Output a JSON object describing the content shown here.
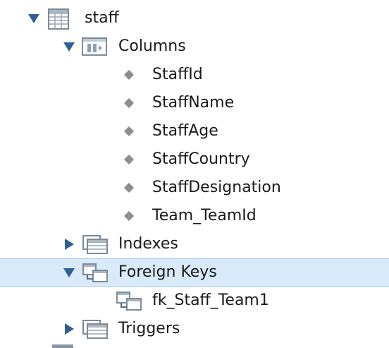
{
  "tree": {
    "table": {
      "label": "staff",
      "icon": "table-icon",
      "expanded": true
    },
    "columns": {
      "label": "Columns",
      "icon": "columns-folder-icon",
      "expanded": true,
      "items": [
        {
          "label": "StaffId"
        },
        {
          "label": "StaffName"
        },
        {
          "label": "StaffAge"
        },
        {
          "label": "StaffCountry"
        },
        {
          "label": "StaffDesignation"
        },
        {
          "label": "Team_TeamId"
        }
      ]
    },
    "indexes": {
      "label": "Indexes",
      "icon": "indexes-folder-icon",
      "expanded": false
    },
    "foreign_keys": {
      "label": "Foreign Keys",
      "icon": "foreign-keys-folder-icon",
      "expanded": true,
      "selected": true,
      "items": [
        {
          "label": "fk_Staff_Team1",
          "icon": "foreign-key-icon"
        }
      ]
    },
    "triggers": {
      "label": "Triggers",
      "icon": "triggers-folder-icon",
      "expanded": false
    }
  },
  "colors": {
    "arrow": "#2f5f97",
    "selection_bg": "#d9ebfb",
    "selection_border": "#9fc8ee",
    "diamond": "#8a8f96",
    "text": "#1a1a1a"
  }
}
